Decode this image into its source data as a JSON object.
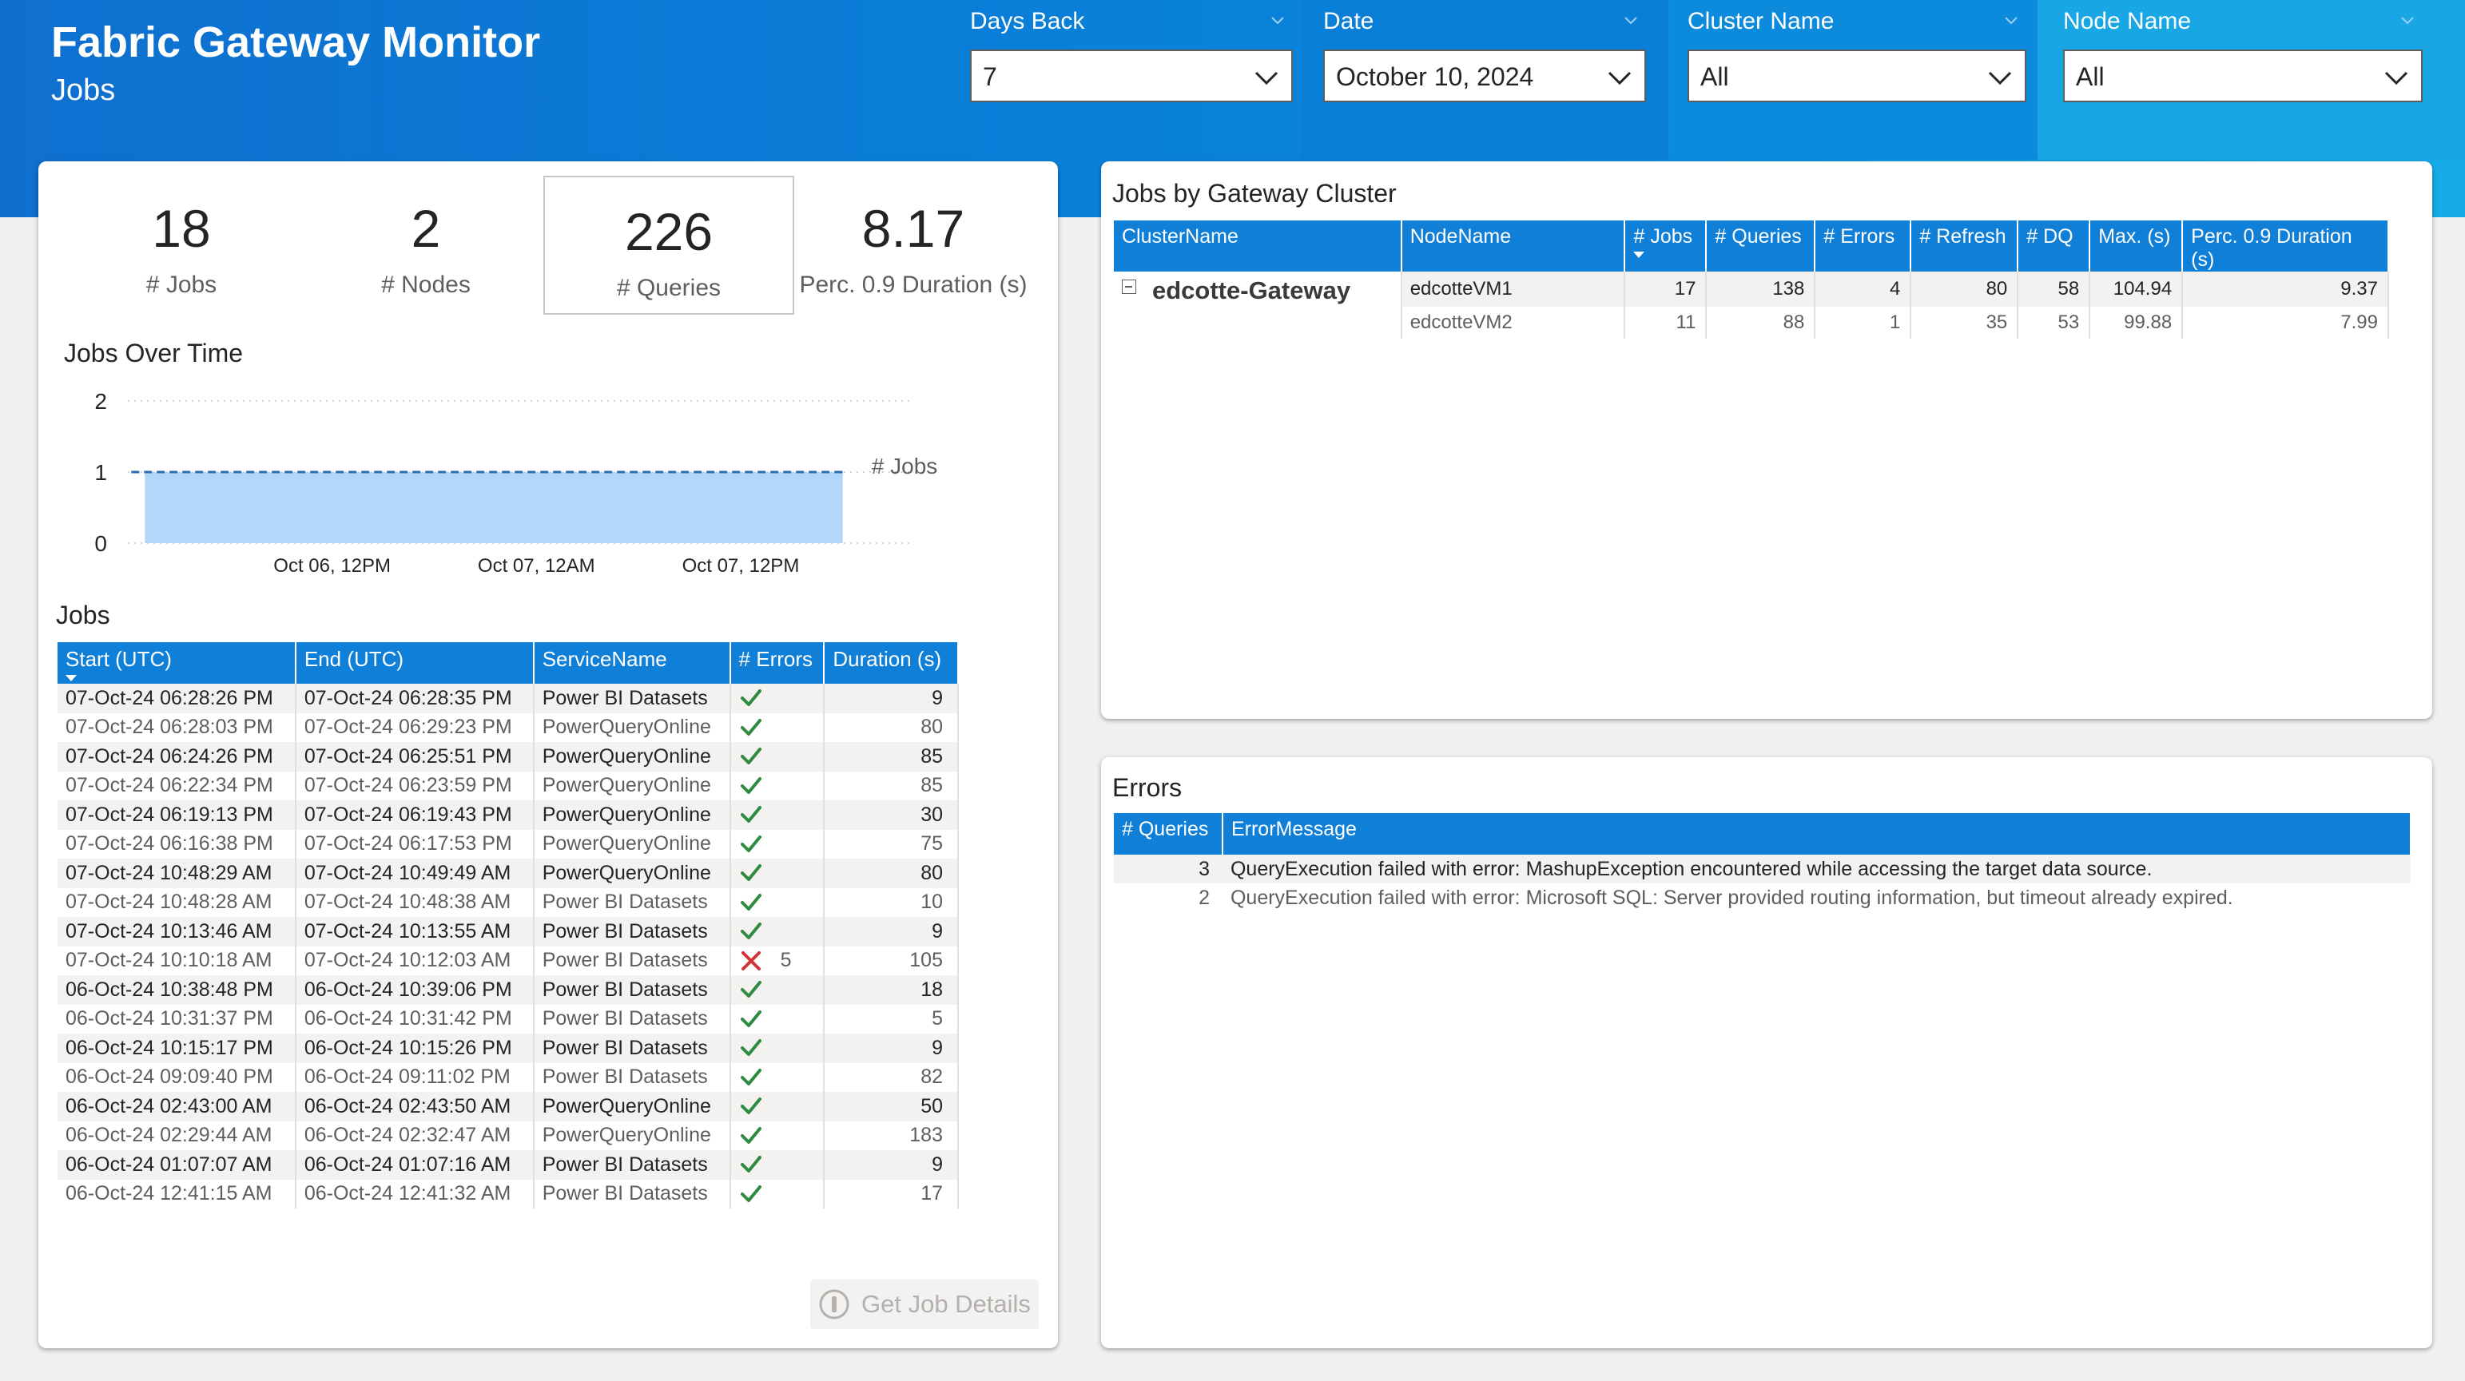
{
  "header": {
    "title": "Fabric Gateway Monitor",
    "subtitle": "Jobs"
  },
  "filters": [
    {
      "label": "Days Back",
      "value": "7"
    },
    {
      "label": "Date",
      "value": "October 10, 2024"
    },
    {
      "label": "Cluster Name",
      "value": "All"
    },
    {
      "label": "Node Name",
      "value": "All"
    }
  ],
  "kpis": [
    {
      "value": "18",
      "label": "# Jobs"
    },
    {
      "value": "2",
      "label": "# Nodes"
    },
    {
      "value": "226",
      "label": "# Queries"
    },
    {
      "value": "8.17",
      "label": "Perc. 0.9 Duration (s)"
    }
  ],
  "chart_section": {
    "title": "Jobs Over Time"
  },
  "chart_data": {
    "type": "area",
    "title": "Jobs Over Time",
    "y_ticks": [
      "0",
      "1",
      "2"
    ],
    "ylim": [
      0,
      2
    ],
    "x_ticks": [
      "Oct 06, 12PM",
      "Oct 07, 12AM",
      "Oct 07, 12PM"
    ],
    "x_tick_hours": [
      12,
      24,
      36
    ],
    "x_start_hour": 1,
    "x_end_hour": 42,
    "series": [
      {
        "name": "# Jobs",
        "value": 1,
        "color": "#b3d7fa",
        "line_color": "#2b6bb3"
      }
    ],
    "grid": true
  },
  "jobs": {
    "title": "Jobs",
    "columns": [
      "Start (UTC)",
      "End (UTC)",
      "ServiceName",
      "# Errors",
      "Duration (s)"
    ],
    "rows": [
      {
        "start": "07-Oct-24 06:28:26 PM",
        "end": "07-Oct-24 06:28:35 PM",
        "service": "Power BI Datasets",
        "status": "ok",
        "errors": "",
        "duration": "9"
      },
      {
        "start": "07-Oct-24 06:28:03 PM",
        "end": "07-Oct-24 06:29:23 PM",
        "service": "PowerQueryOnline",
        "status": "ok",
        "errors": "",
        "duration": "80"
      },
      {
        "start": "07-Oct-24 06:24:26 PM",
        "end": "07-Oct-24 06:25:51 PM",
        "service": "PowerQueryOnline",
        "status": "ok",
        "errors": "",
        "duration": "85"
      },
      {
        "start": "07-Oct-24 06:22:34 PM",
        "end": "07-Oct-24 06:23:59 PM",
        "service": "PowerQueryOnline",
        "status": "ok",
        "errors": "",
        "duration": "85"
      },
      {
        "start": "07-Oct-24 06:19:13 PM",
        "end": "07-Oct-24 06:19:43 PM",
        "service": "PowerQueryOnline",
        "status": "ok",
        "errors": "",
        "duration": "30"
      },
      {
        "start": "07-Oct-24 06:16:38 PM",
        "end": "07-Oct-24 06:17:53 PM",
        "service": "PowerQueryOnline",
        "status": "ok",
        "errors": "",
        "duration": "75"
      },
      {
        "start": "07-Oct-24 10:48:29 AM",
        "end": "07-Oct-24 10:49:49 AM",
        "service": "PowerQueryOnline",
        "status": "ok",
        "errors": "",
        "duration": "80"
      },
      {
        "start": "07-Oct-24 10:48:28 AM",
        "end": "07-Oct-24 10:48:38 AM",
        "service": "Power BI Datasets",
        "status": "ok",
        "errors": "",
        "duration": "10"
      },
      {
        "start": "07-Oct-24 10:13:46 AM",
        "end": "07-Oct-24 10:13:55 AM",
        "service": "Power BI Datasets",
        "status": "ok",
        "errors": "",
        "duration": "9"
      },
      {
        "start": "07-Oct-24 10:10:18 AM",
        "end": "07-Oct-24 10:12:03 AM",
        "service": "Power BI Datasets",
        "status": "error",
        "errors": "5",
        "duration": "105"
      },
      {
        "start": "06-Oct-24 10:38:48 PM",
        "end": "06-Oct-24 10:39:06 PM",
        "service": "Power BI Datasets",
        "status": "ok",
        "errors": "",
        "duration": "18"
      },
      {
        "start": "06-Oct-24 10:31:37 PM",
        "end": "06-Oct-24 10:31:42 PM",
        "service": "Power BI Datasets",
        "status": "ok",
        "errors": "",
        "duration": "5"
      },
      {
        "start": "06-Oct-24 10:15:17 PM",
        "end": "06-Oct-24 10:15:26 PM",
        "service": "Power BI Datasets",
        "status": "ok",
        "errors": "",
        "duration": "9"
      },
      {
        "start": "06-Oct-24 09:09:40 PM",
        "end": "06-Oct-24 09:11:02 PM",
        "service": "Power BI Datasets",
        "status": "ok",
        "errors": "",
        "duration": "82"
      },
      {
        "start": "06-Oct-24 02:43:00 AM",
        "end": "06-Oct-24 02:43:50 AM",
        "service": "PowerQueryOnline",
        "status": "ok",
        "errors": "",
        "duration": "50"
      },
      {
        "start": "06-Oct-24 02:29:44 AM",
        "end": "06-Oct-24 02:32:47 AM",
        "service": "PowerQueryOnline",
        "status": "ok",
        "errors": "",
        "duration": "183"
      },
      {
        "start": "06-Oct-24 01:07:07 AM",
        "end": "06-Oct-24 01:07:16 AM",
        "service": "Power BI Datasets",
        "status": "ok",
        "errors": "",
        "duration": "9"
      },
      {
        "start": "06-Oct-24 12:41:15 AM",
        "end": "06-Oct-24 12:41:32 AM",
        "service": "Power BI Datasets",
        "status": "ok",
        "errors": "",
        "duration": "17"
      }
    ],
    "status_colors": {
      "ok": "#2e8b3f",
      "error": "#d13438"
    },
    "details_button": "Get Job Details"
  },
  "cluster_section": {
    "title": "Jobs by Gateway Cluster",
    "columns": [
      "ClusterName",
      "NodeName",
      "# Jobs",
      "# Queries",
      "# Errors",
      "# Refresh",
      "# DQ",
      "Max. (s)",
      "Perc. 0.9 Duration (s)"
    ],
    "cluster": "edcotte-Gateway",
    "rows": [
      {
        "node": "edcotteVM1",
        "jobs": "17",
        "queries": "138",
        "errors": "4",
        "refresh": "80",
        "dq": "58",
        "max": "104.94",
        "perc": "9.37"
      },
      {
        "node": "edcotteVM2",
        "jobs": "11",
        "queries": "88",
        "errors": "1",
        "refresh": "35",
        "dq": "53",
        "max": "99.88",
        "perc": "7.99"
      }
    ]
  },
  "errors_section": {
    "title": "Errors",
    "columns": [
      "# Queries",
      "ErrorMessage"
    ],
    "rows": [
      {
        "queries": "3",
        "message": "QueryExecution failed with error: MashupException encountered while accessing the target data source."
      },
      {
        "queries": "2",
        "message": "QueryExecution failed with error: Microsoft SQL: Server provided routing information, but timeout already expired."
      }
    ]
  },
  "colors": {
    "accent": "#0f7fd8",
    "header_bg": "#0a7bd6"
  }
}
